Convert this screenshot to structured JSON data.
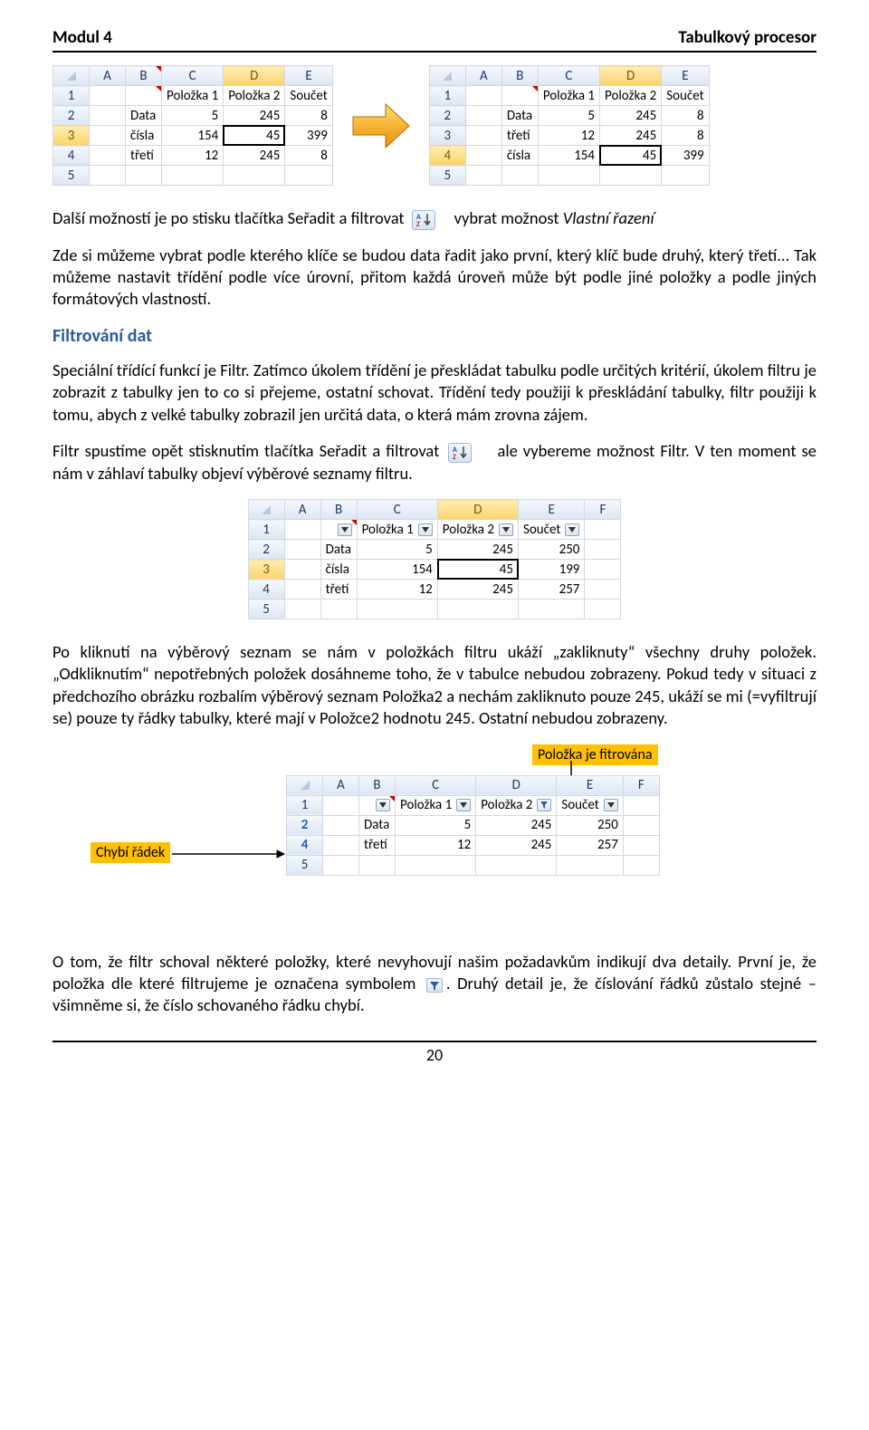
{
  "header": {
    "left": "Modul 4",
    "right": "Tabulkový procesor"
  },
  "fig1": {
    "cols": [
      "A",
      "B",
      "C",
      "D",
      "E"
    ],
    "rows": [
      {
        "n": "1",
        "cells": [
          "",
          "",
          "Položka 1",
          "Položka 2",
          "Součet"
        ]
      },
      {
        "n": "2",
        "cells": [
          "",
          "Data",
          "5",
          "245",
          "8"
        ]
      },
      {
        "n": "3",
        "cells": [
          "",
          "čísla",
          "154",
          "45",
          "399"
        ]
      },
      {
        "n": "4",
        "cells": [
          "",
          "třetí",
          "12",
          "245",
          "8"
        ]
      },
      {
        "n": "5",
        "cells": [
          "",
          "",
          "",
          "",
          ""
        ]
      }
    ]
  },
  "fig1b": {
    "cols": [
      "A",
      "B",
      "C",
      "D",
      "E"
    ],
    "rows": [
      {
        "n": "1",
        "cells": [
          "",
          "",
          "Položka 1",
          "Položka 2",
          "Součet"
        ]
      },
      {
        "n": "2",
        "cells": [
          "",
          "Data",
          "5",
          "245",
          "8"
        ]
      },
      {
        "n": "3",
        "cells": [
          "",
          "třetí",
          "12",
          "245",
          "8"
        ]
      },
      {
        "n": "4",
        "cells": [
          "",
          "čísla",
          "154",
          "45",
          "399"
        ]
      },
      {
        "n": "5",
        "cells": [
          "",
          "",
          "",
          "",
          ""
        ]
      }
    ]
  },
  "p1a": "Další možností je po stisku tlačítka Seřadit a filtrovat",
  "p1b": "vybrat možnost ",
  "p1c": "Vlastní řazení",
  "p2": "Zde si můžeme vybrat podle kterého klíče se budou data řadit jako první, který klíč bude druhý, který třetí... Tak můžeme nastavit třídění podle více úrovní, přitom každá úroveň může být podle jiné položky a podle jiných formátových vlastností.",
  "sec1": "Filtrování dat",
  "p3": "Speciální třídící funkcí je Filtr. Zatímco úkolem třídění je přeskládat tabulku podle určitých kritérií, úkolem filtru je zobrazit z tabulky jen to co si přejeme, ostatní schovat. Třídění tedy použiji k přeskládání tabulky, filtr použiji k tomu, abych z velké tabulky zobrazil jen určitá data, o která mám zrovna zájem.",
  "p4a": "Filtr spustíme opět stisknutím tlačítka Seřadit a filtrovat",
  "p4b": "ale vybereme možnost Filtr. V ten moment se nám v záhlaví tabulky objeví výběrové seznamy filtru.",
  "fig2": {
    "cols": [
      "A",
      "B",
      "C",
      "D",
      "E",
      "F"
    ],
    "headers": [
      "",
      "",
      "Položka 1",
      "Položka 2",
      "Součet",
      ""
    ],
    "rows": [
      {
        "n": "2",
        "cells": [
          "",
          "Data",
          "5",
          "245",
          "250"
        ]
      },
      {
        "n": "3",
        "cells": [
          "",
          "čísla",
          "154",
          "45",
          "199"
        ]
      },
      {
        "n": "4",
        "cells": [
          "",
          "třetí",
          "12",
          "245",
          "257"
        ]
      },
      {
        "n": "5",
        "cells": [
          "",
          "",
          "",
          "",
          ""
        ]
      }
    ]
  },
  "p5": " Po kliknutí na výběrový seznam se nám v položkách filtru ukáží „zakliknuty“ všechny druhy položek. „Odkliknutím“ nepotřebných položek dosáhneme toho, že v tabulce nebudou zobrazeny. Pokud tedy v situaci z předchozího obrázku rozbalím výběrový seznam Položka2 a nechám zakliknuto pouze 245, ukáží se mi (=vyfiltrují se) pouze ty řádky tabulky, které mají v Položce2 hodnotu 245. Ostatní nebudou zobrazeny.",
  "callouts": {
    "top": "Položka je fitrována",
    "left": "Chybí řádek"
  },
  "fig3": {
    "cols": [
      "A",
      "B",
      "C",
      "D",
      "E",
      "F"
    ],
    "headers": [
      "",
      "",
      "Položka 1",
      "Položka 2",
      "Součet",
      ""
    ],
    "rows": [
      {
        "n": "2",
        "cells": [
          "",
          "Data",
          "5",
          "245",
          "250"
        ]
      },
      {
        "n": "4",
        "cells": [
          "",
          "třetí",
          "12",
          "245",
          "257"
        ]
      },
      {
        "n": "5",
        "cells": [
          "",
          "",
          "",
          "",
          ""
        ]
      }
    ]
  },
  "p6a": "O tom, že filtr schoval některé položky, které nevyhovují našim požadavkům indikují dva detaily. První je, že položka dle které filtrujeme je označena symbolem ",
  "p6b": ". Druhý detail je, že číslování řádků zůstalo stejné – všimněme si, že číslo schovaného řádku chybí.",
  "footer": "20"
}
